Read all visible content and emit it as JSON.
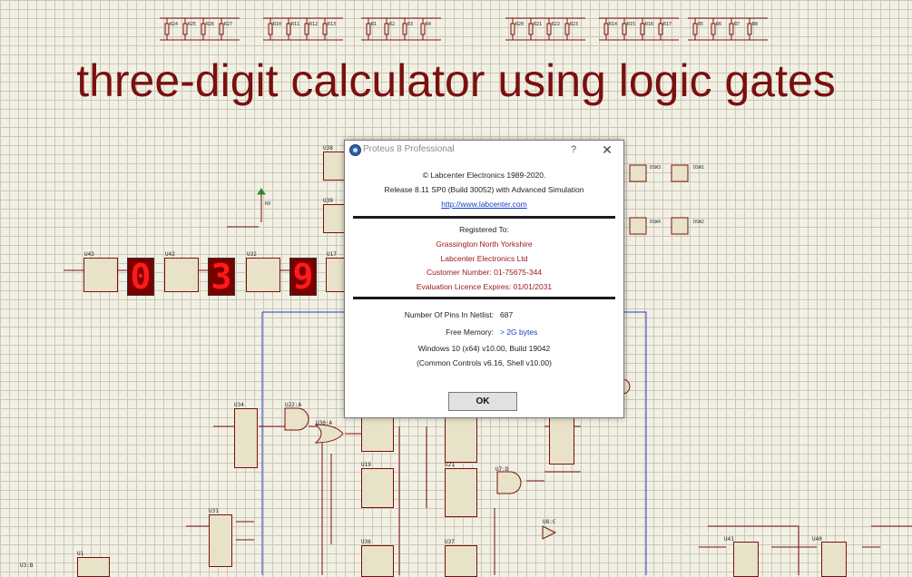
{
  "schematic": {
    "title": "three-digit calculator using logic gates",
    "display_digits": [
      "0",
      "3",
      "9"
    ],
    "resistor_groups": [
      [
        "R24",
        "R25",
        "R26",
        "R27"
      ],
      [
        "R10",
        "R11",
        "R12",
        "R13"
      ],
      [
        "R1",
        "R2",
        "R3",
        "R4"
      ],
      [
        "R20",
        "R21",
        "R22",
        "R23"
      ],
      [
        "R14",
        "R15",
        "R16",
        "R17"
      ],
      [
        "R5",
        "R6",
        "R7",
        "R8"
      ]
    ],
    "ic_labels": [
      "U43",
      "U42",
      "U32",
      "U17",
      "U38",
      "U39",
      "U34",
      "U22:A",
      "U30:A",
      "U18",
      "U19",
      "U21",
      "U7:D",
      "U31",
      "U36",
      "U37",
      "U8:C",
      "U41",
      "U40",
      "U1",
      "U3:B",
      "R9",
      "DSW3",
      "DSW1",
      "DSW4",
      "DSW2"
    ],
    "colors": {
      "title": "#7a1010",
      "wire": "#7a1010",
      "bus": "#2a3ad0",
      "segment": "#ff1a1a"
    }
  },
  "dialog": {
    "title": "Proteus 8 Professional",
    "help_label": "?",
    "close_label": "✕",
    "app_icon": "proteus-app-icon",
    "copyright": "© Labcenter Electronics 1989-2020.",
    "release": "Release 8.11 SP0 (Build 30052) with Advanced Simulation",
    "url": "http://www.labcenter.com",
    "registered_to_label": "Registered To:",
    "reg_line1": "Grassington North Yorkshire",
    "reg_line2": "Labcenter Electronics Ltd",
    "customer_number": "Customer Number: 01-75675-344",
    "licence_expiry": "Evaluation Licence Expires: 01/01/2031",
    "pins_label": "Number Of Pins In Netlist:",
    "pins_value": "687",
    "memory_label": "Free Memory:",
    "memory_value": "> 2G bytes",
    "os_line": "Windows 10 (x64) v10.00, Build 19042",
    "controls_line": "(Common Controls v6.16, Shell v10.00)",
    "ok_label": "OK"
  }
}
